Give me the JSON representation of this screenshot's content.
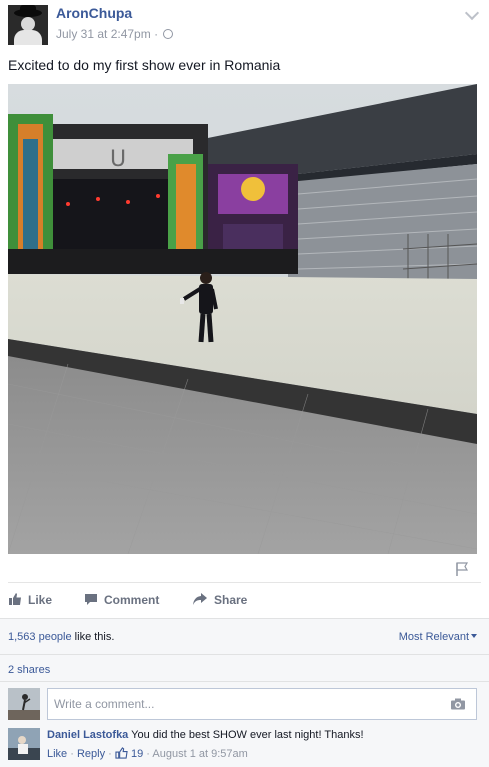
{
  "post": {
    "author": "AronChupa",
    "timestamp": "July 31 at 2:47pm",
    "separator": "·",
    "text": "Excited to do my first show ever in Romania",
    "photo_sign": "U"
  },
  "actions": {
    "like": "Like",
    "comment": "Comment",
    "share": "Share"
  },
  "feedback": {
    "likes_count": "1,563 people",
    "likes_suffix": " like this.",
    "sort_label": "Most Relevant",
    "shares": "2 shares"
  },
  "composer": {
    "placeholder": "Write a comment..."
  },
  "comment": {
    "author": "Daniel Lastofka",
    "text": "You did the best SHOW ever last night! Thanks!",
    "like_label": "Like",
    "reply_label": "Reply",
    "like_count": "19",
    "timestamp": "August 1 at 9:57am",
    "dot": "·"
  },
  "colors": {
    "link": "#3b5998",
    "meta": "#9197a3",
    "feedback_bg": "#f6f7f9"
  },
  "icons": [
    "globe-icon",
    "chevron-down-icon",
    "flag-icon",
    "like-icon",
    "comment-icon",
    "share-icon",
    "camera-icon",
    "thumb-up-icon"
  ]
}
